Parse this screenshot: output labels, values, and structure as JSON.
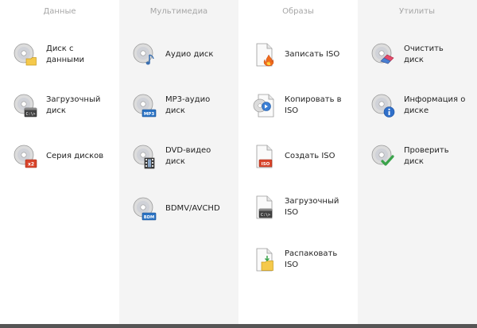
{
  "columns": [
    {
      "header": "Данные",
      "items": [
        {
          "label": "Диск с\nданными",
          "icon": "data-disc-icon"
        },
        {
          "label": "Загрузочный\nдиск",
          "icon": "boot-disc-icon"
        },
        {
          "label": "Серия дисков",
          "icon": "disc-series-icon"
        }
      ]
    },
    {
      "header": "Мультимедиа",
      "items": [
        {
          "label": "Аудио диск",
          "icon": "audio-disc-icon"
        },
        {
          "label": "MP3-аудио\nдиск",
          "icon": "mp3-disc-icon",
          "badge": "MP3"
        },
        {
          "label": "DVD-видео\nдиск",
          "icon": "dvd-video-disc-icon"
        },
        {
          "label": "BDMV/AVCHD",
          "icon": "bdmv-disc-icon",
          "badge": "BDM"
        }
      ]
    },
    {
      "header": "Образы",
      "items": [
        {
          "label": "Записать ISO",
          "icon": "burn-iso-icon"
        },
        {
          "label": "Копировать в\nISO",
          "icon": "copy-to-iso-icon"
        },
        {
          "label": "Создать ISO",
          "icon": "create-iso-icon",
          "badge": "ISO"
        },
        {
          "label": "Загрузочный\nISO",
          "icon": "boot-iso-icon"
        },
        {
          "label": "Распаковать\nISO",
          "icon": "extract-iso-icon"
        }
      ]
    },
    {
      "header": "Утилиты",
      "items": [
        {
          "label": "Очистить\nдиск",
          "icon": "erase-disc-icon"
        },
        {
          "label": "Информация о\nдиске",
          "icon": "disc-info-icon"
        },
        {
          "label": "Проверить\nдиск",
          "icon": "verify-disc-icon"
        }
      ]
    }
  ],
  "colors": {
    "header_text": "#a6a6a6",
    "alt_column_bg": "#f4f4f4",
    "bottom_bar": "#555555"
  }
}
